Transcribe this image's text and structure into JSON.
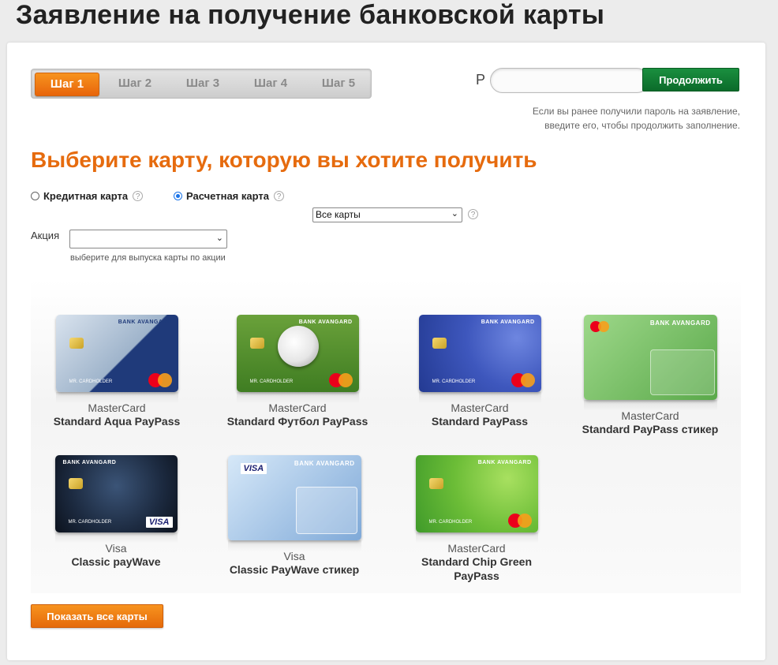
{
  "title": "Заявление на получение банковской карты",
  "steps": [
    "Шаг 1",
    "Шаг 2",
    "Шаг 3",
    "Шаг 4",
    "Шаг 5"
  ],
  "active_step": "Шаг 1",
  "password": {
    "label": "Р",
    "value": "",
    "button": "Продолжить",
    "hint_line1": "Если вы ранее получили пароль на заявление,",
    "hint_line2": "введите его, чтобы продолжить заполнение."
  },
  "heading": "Выберите карту, которую вы хотите получить",
  "card_kind": {
    "credit_label": "Кредитная карта",
    "debit_label": "Расчетная карта",
    "selected": "Расчетная карта",
    "help": "?"
  },
  "filter_select": {
    "value": "Все карты"
  },
  "promo": {
    "label": "Акция",
    "value": "",
    "hint": "выберите для выпуска карты по акции"
  },
  "card_text": {
    "bank": "BANK AVANGARD",
    "holder": "MR. CARDHOLDER",
    "visa": "VISA"
  },
  "cards": [
    {
      "type": "MasterCard",
      "name": "Standard Aqua PayPass",
      "color1": "#c9d6e3",
      "color2": "#1f3a7a"
    },
    {
      "type": "MasterCard",
      "name": "Standard Футбол PayPass",
      "color1": "#7fb543",
      "color2": "#2f6a1c"
    },
    {
      "type": "MasterCard",
      "name": "Standard PayPass",
      "color1": "#4a63c2",
      "color2": "#243a8f"
    },
    {
      "type": "MasterCard",
      "name": "Standard PayPass стикер",
      "color1": "#8fcf7a",
      "color2": "#4d9a3e"
    },
    {
      "type": "Visa",
      "name": "Classic payWave",
      "color1": "#2c3e58",
      "color2": "#0e1623"
    },
    {
      "type": "Visa",
      "name": "Classic PayWave стикер",
      "color1": "#b8d4f0",
      "color2": "#5b8fc8"
    },
    {
      "type": "MasterCard",
      "name": "Standard Chip Green PayPass",
      "color1": "#8bd14a",
      "color2": "#3f9a2a"
    }
  ],
  "show_all_button": "Показать все карты",
  "colors": {
    "accent": "#e66b0e",
    "green_button": "#0b6b2a"
  }
}
